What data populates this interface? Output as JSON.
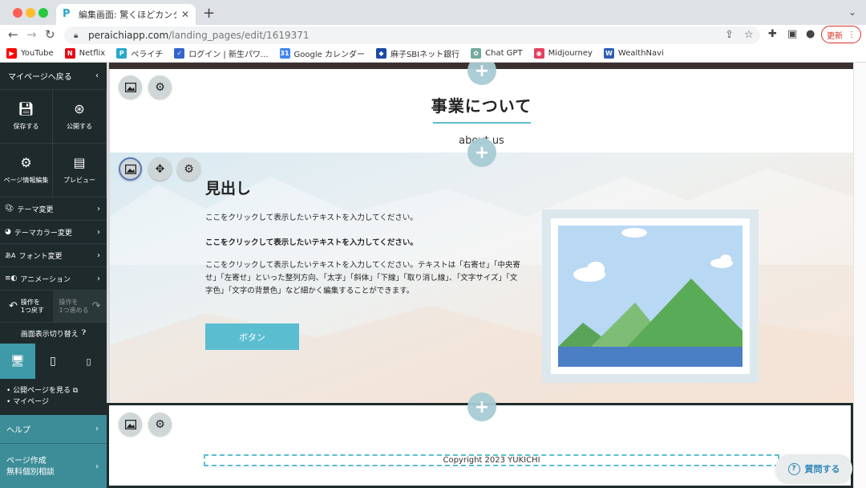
{
  "browser": {
    "tab_title": "編集画面: 驚くほどカンタン！無料",
    "url_domain": "peraichiapp.com",
    "url_path": "/landing_pages/edit/1619371",
    "update_label": "更新"
  },
  "bookmarks": [
    {
      "label": "YouTube",
      "icon": "youtube-icon",
      "color": "#ff0000"
    },
    {
      "label": "Netflix",
      "icon": "netflix-icon",
      "color": "#e50914"
    },
    {
      "label": "ペライチ",
      "icon": "peraichi-icon",
      "color": "#2aa7c9"
    },
    {
      "label": "ログイン | 新生パワ...",
      "icon": "login-icon",
      "color": "#3366cc"
    },
    {
      "label": "Google カレンダー",
      "icon": "calendar-icon",
      "color": "#4285f4"
    },
    {
      "label": "麻子SBIネット銀行",
      "icon": "bank-icon",
      "color": "#1a4aa8"
    },
    {
      "label": "Chat GPT",
      "icon": "chatgpt-icon",
      "color": "#74aa9c"
    },
    {
      "label": "Midjourney",
      "icon": "midjourney-icon",
      "color": "#e4405f"
    },
    {
      "label": "WealthNavi",
      "icon": "wealthnavi-icon",
      "color": "#2f5fb3"
    }
  ],
  "sidebar": {
    "back_label": "マイページへ戻る",
    "save_label": "保存する",
    "publish_label": "公開する",
    "page_info_label": "ページ情報編集",
    "preview_label": "プレビュー",
    "menu": [
      {
        "label": "テーマ変更",
        "icon": "palette-icon"
      },
      {
        "label": "テーマカラー変更",
        "icon": "color-palette-icon"
      },
      {
        "label": "フォント変更",
        "icon": "font-icon"
      },
      {
        "label": "アニメーション",
        "icon": "animation-icon"
      }
    ],
    "undo_label_1": "操作を",
    "undo_label_2": "1つ戻す",
    "redo_label_1": "操作を",
    "redo_label_2": "1つ進める",
    "display_switch_label": "画面表示切り替え",
    "links": [
      "公開ページを見る",
      "マイページ"
    ],
    "help_label": "ヘルプ",
    "create_label_1": "ページ作成",
    "create_label_2": "無料個別相談"
  },
  "canvas": {
    "section_title": "事業について",
    "section_subtitle": "about us",
    "content_heading": "見出し",
    "para1": "ここをクリックして表示したいテキストを入力してください。",
    "para2": "ここをクリックして表示したいテキストを入力してください。",
    "para3": "ここをクリックして表示したいテキストを入力してください。テキストは「右寄せ」「中央寄せ」「左寄せ」といった整列方向、「太字」「斜体」「下線」「取り消し線」、「文字サイズ」「文字色」「文字の背景色」など細かく編集することができます。",
    "button_label": "ボタン",
    "copyright": "Copyright 2023 YUKICHI"
  },
  "help_widget": {
    "label": "質問する"
  },
  "colors": {
    "accent": "#5bbdd0",
    "panel": "#1e2a2c",
    "help": "#3d8d98"
  }
}
